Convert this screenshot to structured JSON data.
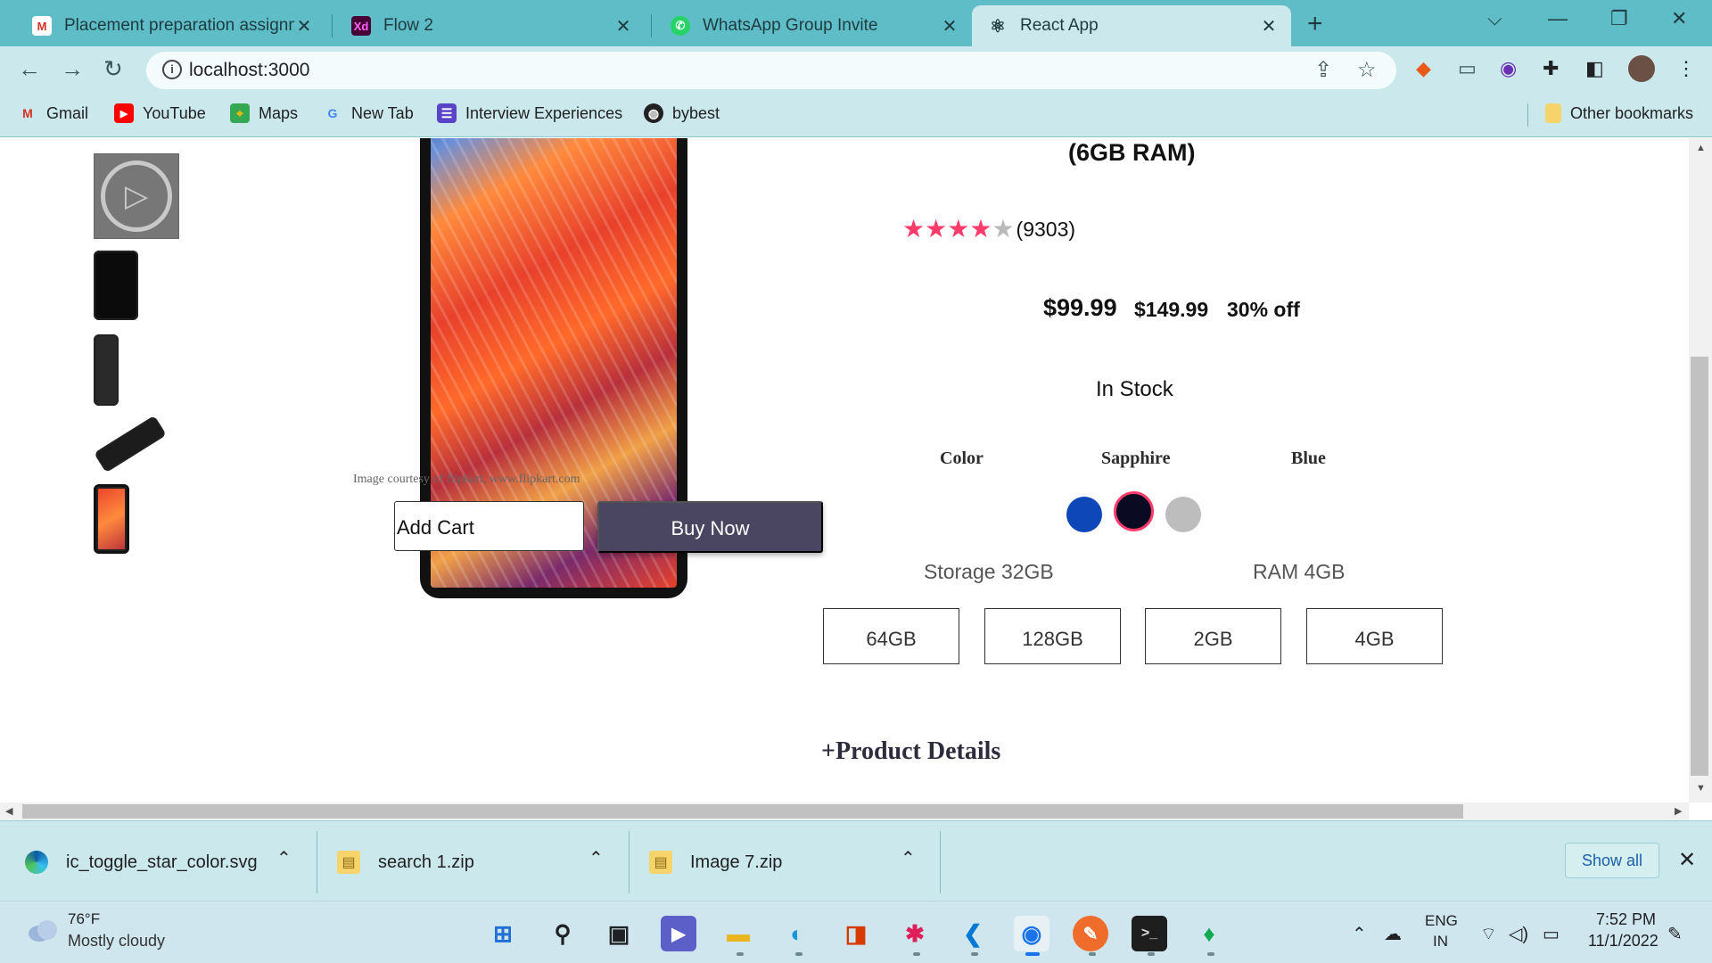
{
  "browser": {
    "tabs": [
      {
        "title": "Placement preparation assignme",
        "icon": "gmail-icon",
        "active": false
      },
      {
        "title": "Flow 2",
        "icon": "adobe-xd-icon",
        "active": false
      },
      {
        "title": "WhatsApp Group Invite",
        "icon": "whatsapp-icon",
        "active": false
      },
      {
        "title": "React App",
        "icon": "react-icon",
        "active": true
      }
    ],
    "address": "localhost:3000",
    "bookmarks": [
      {
        "label": "Gmail",
        "icon": "gmail-icon"
      },
      {
        "label": "YouTube",
        "icon": "youtube-icon"
      },
      {
        "label": "Maps",
        "icon": "maps-icon"
      },
      {
        "label": "New Tab",
        "icon": "google-icon"
      },
      {
        "label": "Interview Experiences",
        "icon": "list-icon"
      },
      {
        "label": "bybest",
        "icon": "globe-icon"
      }
    ],
    "other_bookmarks": "Other bookmarks"
  },
  "product": {
    "title": "(6GB RAM)",
    "rating": {
      "stars": 4,
      "max": 5,
      "count": "(9303)"
    },
    "price": "$99.99",
    "mrp": "$149.99",
    "discount": "30% off",
    "stock": "In Stock",
    "image_credit": "Image courtesy of flipkart, www.flipkart.com",
    "add_cart": "Add Cart",
    "buy_now": "Buy Now",
    "color_labels": [
      "Color",
      "Sapphire",
      "Blue"
    ],
    "swatches": [
      {
        "name": "blue",
        "color": "#0d47b8",
        "selected": false
      },
      {
        "name": "black",
        "color": "#0a0b22",
        "selected": true
      },
      {
        "name": "silver",
        "color": "#bdbdbd",
        "selected": false
      }
    ],
    "storage_label": "Storage 32GB",
    "ram_label": "RAM 4GB",
    "options": [
      "64GB",
      "128GB",
      "2GB",
      "4GB"
    ],
    "details": "+Product Details"
  },
  "colors": {
    "accent_pink": "#ff3b6b",
    "buy_button": "#4a4560",
    "tab_strip": "#5ebdc6",
    "toolbar": "#cbe9ec"
  },
  "downloads": {
    "items": [
      {
        "name": "ic_toggle_star_color.svg",
        "icon": "edge-icon"
      },
      {
        "name": "search 1.zip",
        "icon": "zip-folder-icon"
      },
      {
        "name": "Image 7.zip",
        "icon": "zip-folder-icon"
      }
    ],
    "show_all": "Show all"
  },
  "taskbar": {
    "weather_temp": "76°F",
    "weather_desc": "Mostly cloudy",
    "lang": "ENG",
    "region": "IN",
    "time": "7:52 PM",
    "date": "11/1/2022"
  }
}
